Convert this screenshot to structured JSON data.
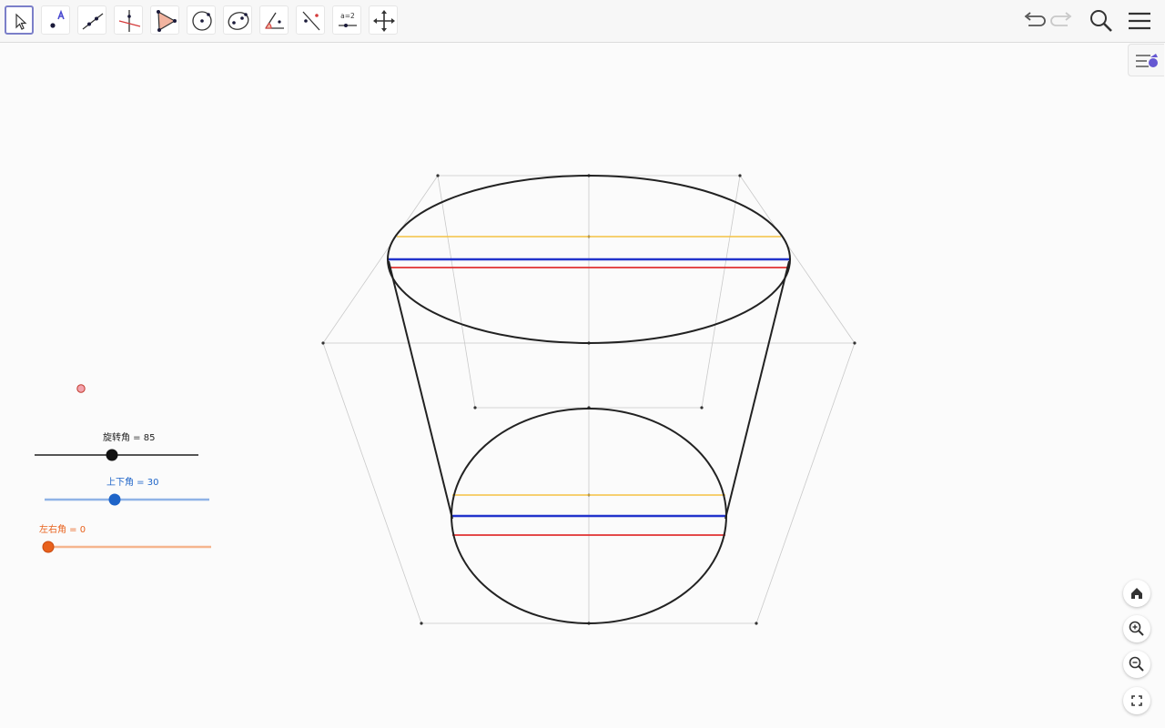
{
  "toolbar": {
    "tools": [
      {
        "id": "move",
        "label": "Move",
        "icon": "cursor-arrow-icon"
      },
      {
        "id": "point",
        "label": "Point",
        "icon": "point-icon"
      },
      {
        "id": "line",
        "label": "Line",
        "icon": "line-icon"
      },
      {
        "id": "perpendicular",
        "label": "Perpendicular Line",
        "icon": "perpendicular-line-icon"
      },
      {
        "id": "polygon",
        "label": "Polygon",
        "icon": "polygon-icon"
      },
      {
        "id": "circle-center",
        "label": "Circle with Center through Point",
        "icon": "circle-center-icon"
      },
      {
        "id": "ellipse",
        "label": "Ellipse",
        "icon": "ellipse-icon"
      },
      {
        "id": "angle",
        "label": "Angle",
        "icon": "angle-icon"
      },
      {
        "id": "reflect",
        "label": "Reflect about Line",
        "icon": "reflect-icon"
      },
      {
        "id": "slider",
        "label": "Slider",
        "icon": "slider-icon",
        "text": "a=2"
      },
      {
        "id": "move-graphics",
        "label": "Move Graphics View",
        "icon": "move-graphics-icon"
      }
    ],
    "undo_icon": "undo-icon",
    "redo_icon": "redo-icon",
    "search_icon": "search-icon",
    "menu_icon": "menu-icon"
  },
  "style_bar_icon": "style-bar-icon",
  "sliders": [
    {
      "label": "旋转角 = 85",
      "value": 85,
      "color": "#222222"
    },
    {
      "label": "上下角 = 30",
      "value": 30,
      "color": "#1e64c8"
    },
    {
      "label": "左右角 = 0",
      "value": 0,
      "color": "#e8611c"
    }
  ],
  "nav_buttons": [
    {
      "icon": "home-icon"
    },
    {
      "icon": "zoom-in-icon"
    },
    {
      "icon": "zoom-out-icon"
    },
    {
      "icon": "fullscreen-icon"
    }
  ],
  "colors": {
    "accent": "#6557d2",
    "yellow_line": "#f5c242",
    "blue_line": "#2233cc",
    "red_line": "#e03030",
    "outline": "#222222",
    "construction": "#bdbdbd"
  }
}
